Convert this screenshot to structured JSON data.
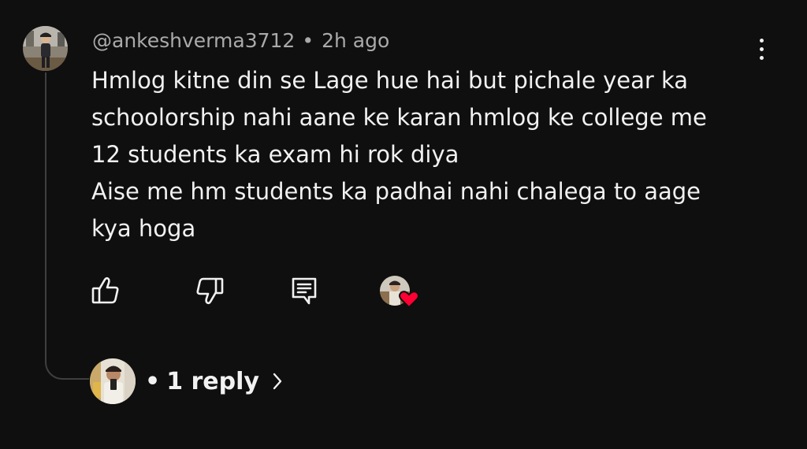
{
  "comment": {
    "author": "@ankeshverma3712",
    "separator": "•",
    "time": "2h ago",
    "lines": [
      "Hmlog kitne din se Lage hue hai but pichale year ka",
      "schoolorship nahi aane ke karan hmlog ke college me",
      "12 students ka exam hi rok diya",
      "Aise me hm students ka padhai nahi chalega to aage",
      "kya hoga"
    ]
  },
  "actions": {
    "like_icon": "thumbs-up-icon",
    "dislike_icon": "thumbs-down-icon",
    "reply_icon": "reply-comment-icon",
    "creator_heart_icon": "heart-icon"
  },
  "replies": {
    "bullet": "•",
    "label": "1 reply",
    "chevron_icon": "chevron-right-icon"
  },
  "colors": {
    "background": "#0f0f0f",
    "primary_text": "#f1f1f1",
    "secondary_text": "#aaaaaa",
    "thread_line": "#3f3f3f",
    "heart": "#ff0033"
  }
}
